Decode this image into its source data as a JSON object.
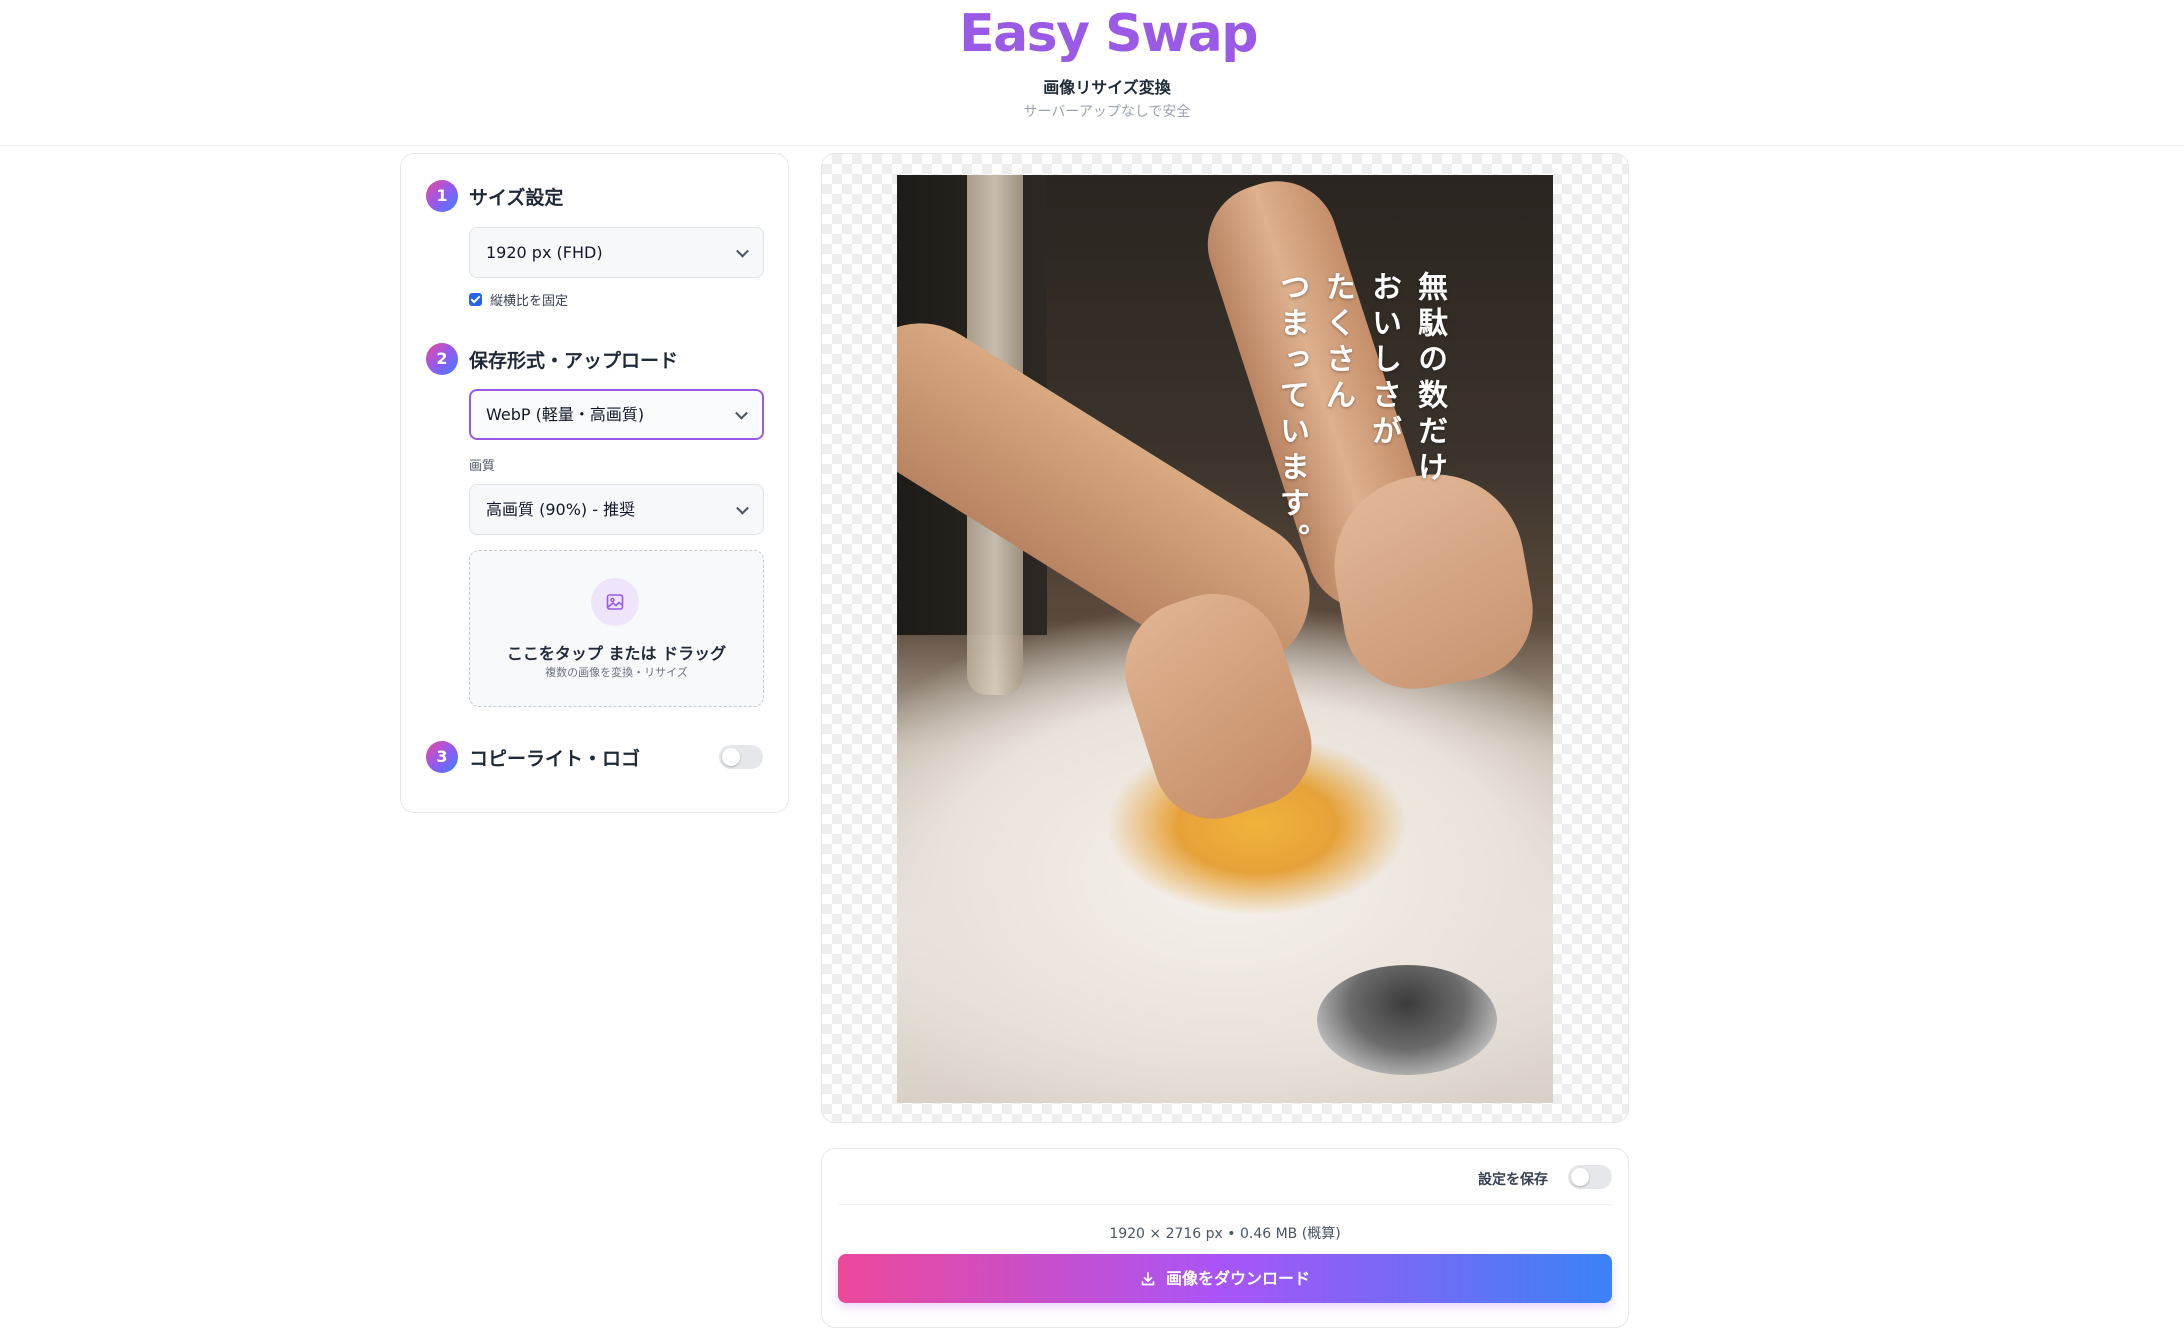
{
  "header": {
    "brand": "Easy Swap",
    "subtitle": "画像リサイズ変換",
    "tagline": "サーバーアップなしで安全"
  },
  "steps": [
    {
      "number": "1",
      "title": "サイズ設定"
    },
    {
      "number": "2",
      "title": "保存形式・アップロード"
    },
    {
      "number": "3",
      "title": "コピーライト・ロゴ"
    }
  ],
  "size": {
    "selected": "1920 px (FHD)",
    "lock_aspect_label": "縦横比を固定",
    "lock_aspect_checked": true
  },
  "format": {
    "selected": "WebP (軽量・高画質)",
    "quality_label": "画質",
    "quality_selected": "高画質 (90%) - 推奨"
  },
  "dropzone": {
    "title": "ここをタップ または ドラッグ",
    "subtitle": "複数の画像を変換・リサイズ",
    "icon": "image-icon"
  },
  "copyright_toggle_on": false,
  "preview": {
    "overlay_text_lines": [
      "無駄の数だけ",
      "おいしさが",
      "たくさん",
      "つまっています。"
    ]
  },
  "download": {
    "save_settings_label": "設定を保存",
    "save_settings_on": false,
    "meta": "1920 × 2716 px • 0.46 MB (概算)",
    "button_label": "画像をダウンロード",
    "icon": "download-icon"
  },
  "colors": {
    "brand": "#9a5ae6",
    "gradient_start": "#ec4899",
    "gradient_mid": "#a855f7",
    "gradient_end": "#3b82f6"
  }
}
